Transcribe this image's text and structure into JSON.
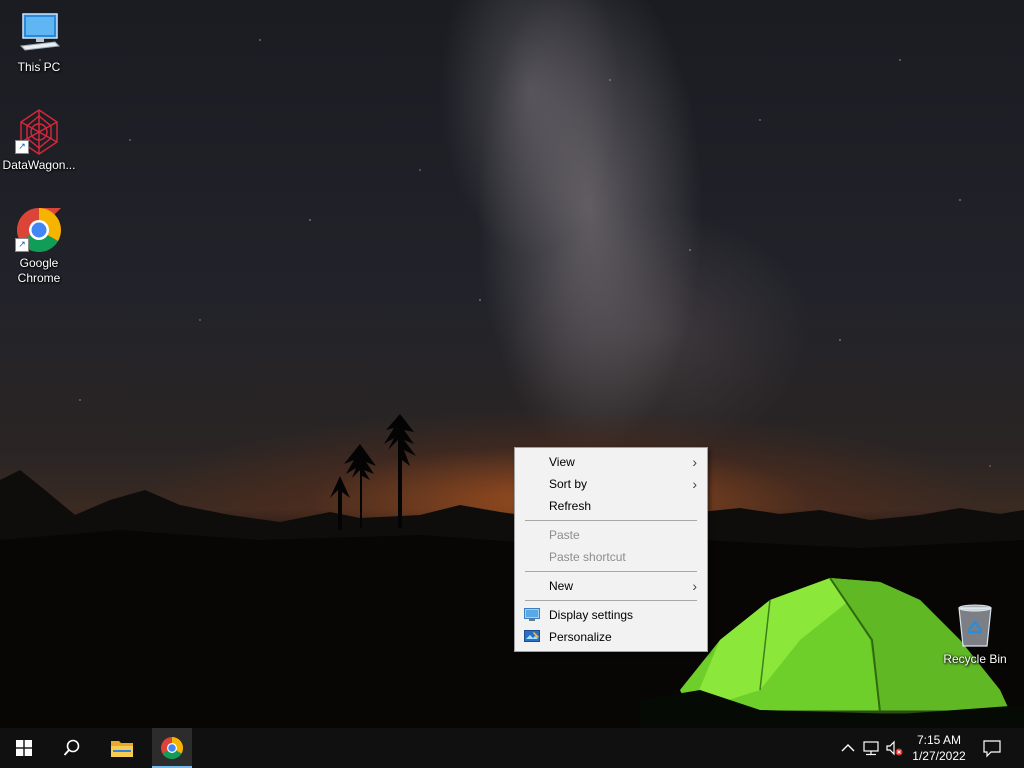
{
  "desktop": {
    "icons": [
      {
        "label": "This PC",
        "icon": "this-pc-icon"
      },
      {
        "label": "DataWagon...",
        "icon": "datawagon-icon"
      },
      {
        "label": "Google Chrome",
        "icon": "chrome-icon"
      },
      {
        "label": "Recycle Bin",
        "icon": "recycle-bin-icon"
      }
    ]
  },
  "context_menu": {
    "items": [
      {
        "label": "View",
        "has_submenu": true,
        "enabled": true
      },
      {
        "label": "Sort by",
        "has_submenu": true,
        "enabled": true
      },
      {
        "label": "Refresh",
        "has_submenu": false,
        "enabled": true
      },
      {
        "label": "Paste",
        "has_submenu": false,
        "enabled": false
      },
      {
        "label": "Paste shortcut",
        "has_submenu": false,
        "enabled": false
      },
      {
        "label": "New",
        "has_submenu": true,
        "enabled": true
      },
      {
        "label": "Display settings",
        "has_submenu": false,
        "enabled": true,
        "icon": "display-settings-icon"
      },
      {
        "label": "Personalize",
        "has_submenu": false,
        "enabled": true,
        "icon": "personalize-icon"
      }
    ]
  },
  "taskbar": {
    "start_icon": "windows-logo-icon",
    "search_icon": "search-icon",
    "pinned": [
      {
        "name": "File Explorer",
        "icon": "folder-icon"
      },
      {
        "name": "Google Chrome",
        "icon": "chrome-icon",
        "active": true
      }
    ],
    "tray": {
      "icons": [
        "chevron-up-icon",
        "network-icon",
        "volume-muted-icon",
        "notification-icon"
      ],
      "time": "7:15 AM",
      "date": "1/27/2022"
    }
  },
  "colors": {
    "taskbar_bg": "#101010",
    "menu_bg": "#f2f2f2",
    "active_task_underline": "#76b9ed",
    "tent_green": "#7ee030"
  }
}
